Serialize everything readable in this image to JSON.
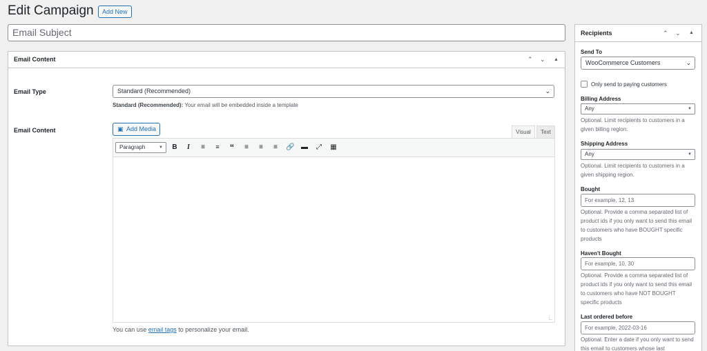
{
  "header": {
    "title": "Edit Campaign",
    "add_new": "Add New"
  },
  "subject": {
    "placeholder": "Email Subject"
  },
  "content_box": {
    "title": "Email Content",
    "email_type_label": "Email Type",
    "email_type_value": "Standard (Recommended)",
    "email_type_desc_bold": "Standard (Recommended):",
    "email_type_desc": " Your email will be embedded inside a template",
    "email_content_label": "Email Content",
    "add_media": "Add Media",
    "tab_visual": "Visual",
    "tab_text": "Text",
    "format_value": "Paragraph",
    "footer_pre": "You can use ",
    "footer_link": "email tags",
    "footer_post": " to personalize your email."
  },
  "recipients": {
    "title": "Recipients",
    "send_to_label": "Send To",
    "send_to_value": "WooCommerce Customers",
    "paying_only": "Only send to paying customers",
    "billing_label": "Billing Address",
    "billing_value": "Any",
    "billing_desc": "Optional. Limit recipients to customers in a given billing region.",
    "shipping_label": "Shipping Address",
    "shipping_value": "Any",
    "shipping_desc": "Optional. Limit recipients to customers in a given shipping region.",
    "bought_label": "Bought",
    "bought_placeholder": "For example, 12, 13",
    "bought_desc": "Optional. Provide a comma separated list of product ids if you only want to send this email to customers who have BOUGHT specific products",
    "not_bought_label": "Haven't Bought",
    "not_bought_placeholder": "For example, 10, 30",
    "not_bought_desc": "Optional. Provide a comma separated list of product ids if you only want to send this email to customers who have NOT BOUGHT specific products",
    "last_ordered_label": "Last ordered before",
    "last_ordered_placeholder": "For example, 2022-03-16",
    "last_ordered_desc": "Optional. Enter a date if you only want to send this email to customers whose last"
  },
  "icons": {
    "collapse_up": "chevron-up-icon",
    "collapse_down": "chevron-down-icon",
    "toggle": "triangle-up-icon"
  }
}
